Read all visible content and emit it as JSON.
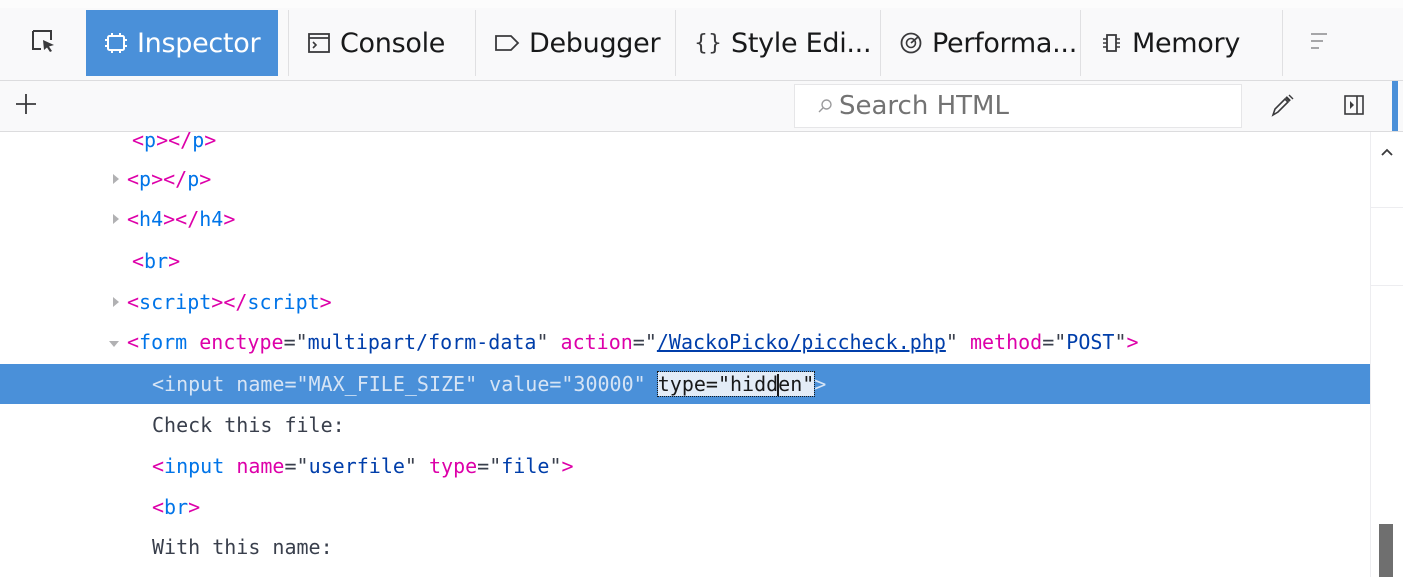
{
  "tabs": [
    {
      "label": "Inspector",
      "icon": "inspector-icon",
      "selected": true
    },
    {
      "label": "Console",
      "icon": "console-icon",
      "selected": false
    },
    {
      "label": "Debugger",
      "icon": "debugger-icon",
      "selected": false
    },
    {
      "label": "Style Edi...",
      "icon": "style-editor-icon",
      "selected": false
    },
    {
      "label": "Performa...",
      "icon": "performance-icon",
      "selected": false
    },
    {
      "label": "Memory",
      "icon": "memory-icon",
      "selected": false
    }
  ],
  "toolbar": {
    "search_placeholder": "Search HTML"
  },
  "tree": {
    "lines": [
      {
        "open": "<",
        "name": "p",
        "close": "></",
        "name2": "p",
        "end": ">"
      },
      {
        "open": "<",
        "name": "p",
        "close": "></",
        "name2": "p",
        "end": ">"
      },
      {
        "open": "<",
        "name": "h4",
        "close": "></",
        "name2": "h4",
        "end": ">"
      },
      {
        "open": "<",
        "name": "br",
        "end": ">"
      },
      {
        "open": "<",
        "name": "script",
        "close": "></",
        "name2": "script",
        "end": ">"
      }
    ],
    "form": {
      "open": "<",
      "name": "form",
      "attrs": [
        {
          "name": "enctype",
          "value": "multipart/form-data"
        },
        {
          "name": "action",
          "value": "/WackoPicko/piccheck.php",
          "link": true
        },
        {
          "name": "method",
          "value": "POST"
        }
      ],
      "end": ">"
    },
    "selected_input": {
      "prefix": "<input name=\"MAX_FILE_SIZE\" value=\"30000\" ",
      "edit_before": "type=\"hidd",
      "edit_after": "en\"",
      "end": ">"
    },
    "text_check": "Check this file:",
    "userfile_input": {
      "open": "<",
      "name": "input",
      "attrs": [
        {
          "name": "name",
          "value": "userfile"
        },
        {
          "name": "type",
          "value": "file"
        }
      ],
      "end": ">"
    },
    "br2": {
      "open": "<",
      "name": "br",
      "end": ">"
    },
    "text_name": "With this name:"
  },
  "colors": {
    "accent": "#4a90d9",
    "tag_bracket": "#dd00a9",
    "tag_name": "#0074e8",
    "attr_value": "#003eaa"
  }
}
